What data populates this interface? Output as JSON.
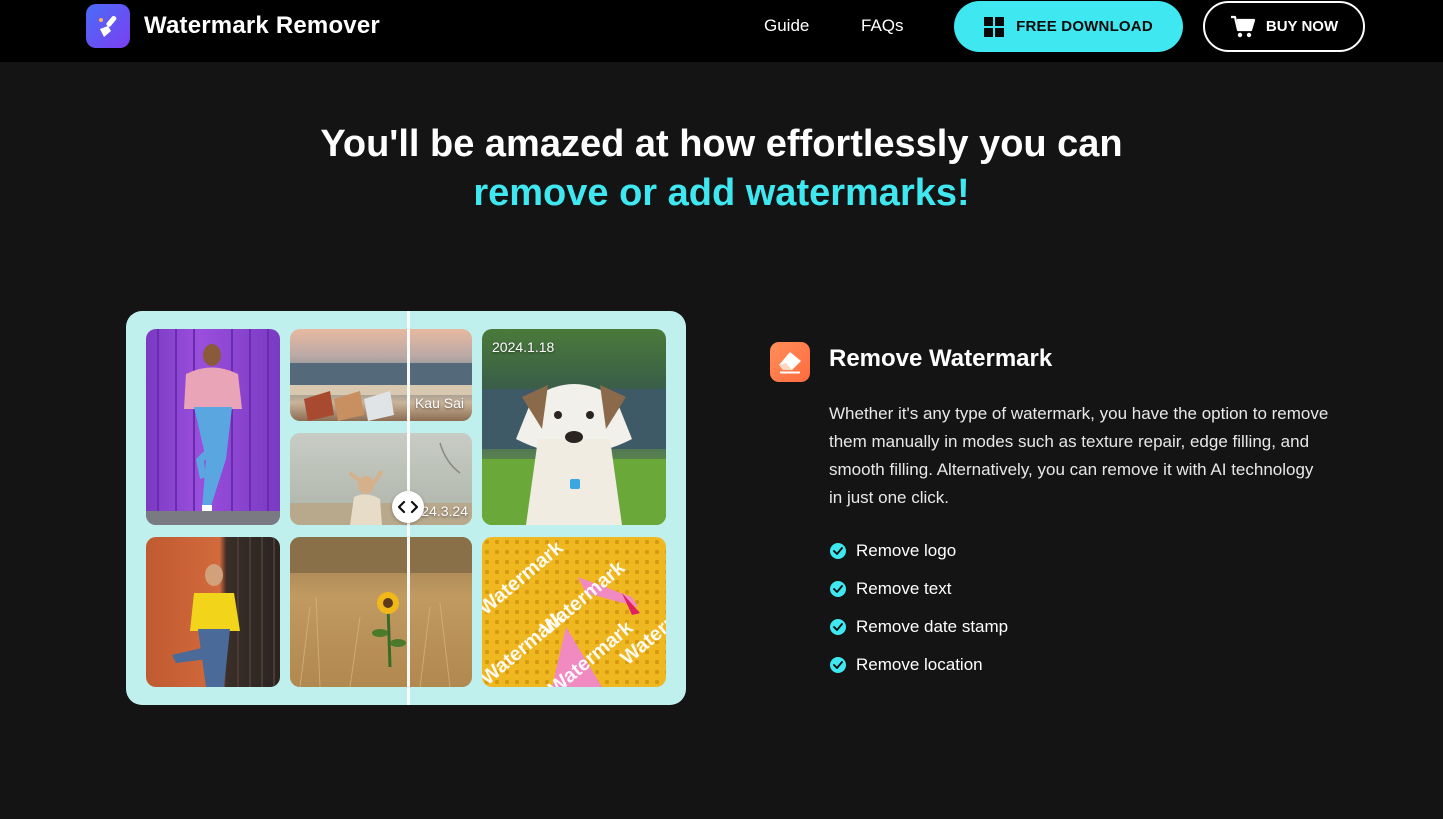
{
  "nav": {
    "brand": "Watermark Remover",
    "links": [
      {
        "label": "Guide"
      },
      {
        "label": "FAQs"
      }
    ],
    "download_label": "FREE DOWNLOAD",
    "buy_label": "BUY NOW",
    "accent": "#3fe8f0"
  },
  "hero": {
    "line1": "You'll be amazed at how effortlessly you can",
    "line2": "remove or add watermarks!"
  },
  "showcase": {
    "labels": {
      "beach": "Kau Sai",
      "dog": "2024.1.18",
      "girl": "24.3.24"
    },
    "watermark_word": "Watermark"
  },
  "feature": {
    "icon": "eraser-icon",
    "title": "Remove Watermark",
    "description": "Whether it's any type of watermark, you have the option to remove them manually in modes such as texture repair, edge filling, and smooth filling. Alternatively, you can remove it with AI technology in just one click.",
    "items": [
      {
        "label": "Remove logo"
      },
      {
        "label": "Remove text"
      },
      {
        "label": "Remove date stamp"
      },
      {
        "label": "Remove location"
      }
    ]
  }
}
